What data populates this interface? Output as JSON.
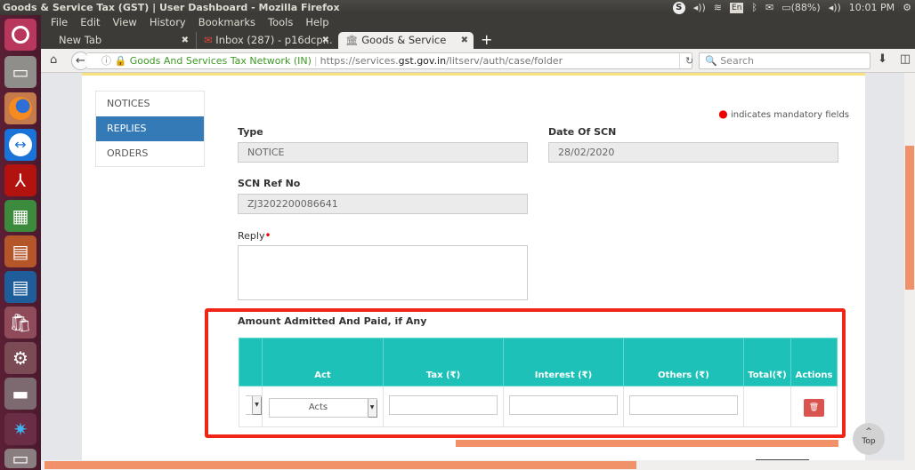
{
  "window": {
    "title": "Goods & Service Tax (GST) | User Dashboard - Mozilla Firefox"
  },
  "tray": {
    "skype": "S",
    "volume_icon": "speaker-icon",
    "wifi_icon": "wifi-icon",
    "keyboard": "En",
    "bluetooth_icon": "bluetooth-icon",
    "mail_icon": "mail-icon",
    "battery": "(88%)",
    "time": "10:01 PM"
  },
  "launcher": {
    "items": [
      "ubuntu-dash",
      "files",
      "firefox",
      "teamviewer",
      "adobe-reader",
      "libreoffice-calc",
      "libreoffice-impress",
      "libreoffice-writer",
      "software-center",
      "system-settings",
      "disk",
      "paint",
      "trash"
    ]
  },
  "menubar": {
    "items": [
      "File",
      "Edit",
      "View",
      "History",
      "Bookmarks",
      "Tools",
      "Help"
    ]
  },
  "tabs": [
    {
      "label": "New Tab",
      "active": false
    },
    {
      "label": "Inbox (287) - p16dcp...",
      "active": false
    },
    {
      "label": "Goods & Service Tax...",
      "active": true
    }
  ],
  "navbar": {
    "identity": "Goods And Services Tax Network (IN)",
    "url_prefix": "https://services.",
    "url_host": "gst.gov.in",
    "url_path": "/litserv/auth/case/folder",
    "search_placeholder": "Search"
  },
  "page": {
    "subnav": [
      {
        "label": "NOTICES",
        "active": false
      },
      {
        "label": "REPLIES",
        "active": true
      },
      {
        "label": "ORDERS",
        "active": false
      }
    ],
    "mandatory_note": "indicates mandatory fields",
    "fields": {
      "type_label": "Type",
      "type_value": "NOTICE",
      "date_label": "Date Of SCN",
      "date_value": "28/02/2020",
      "scn_label": "SCN Ref No",
      "scn_value": "ZJ3202200086641",
      "reply_label": "Reply",
      "reply_value": ""
    },
    "amount_section": {
      "heading": "Amount Admitted And Paid, if Any",
      "columns": [
        "",
        "Act",
        "Tax (₹)",
        "Interest (₹)",
        "Others (₹)",
        "Total(₹)",
        "Actions"
      ],
      "rows": [
        {
          "act": "Acts",
          "tax": "",
          "interest": "",
          "others": "",
          "total": ""
        }
      ]
    },
    "top_button": "Top"
  }
}
